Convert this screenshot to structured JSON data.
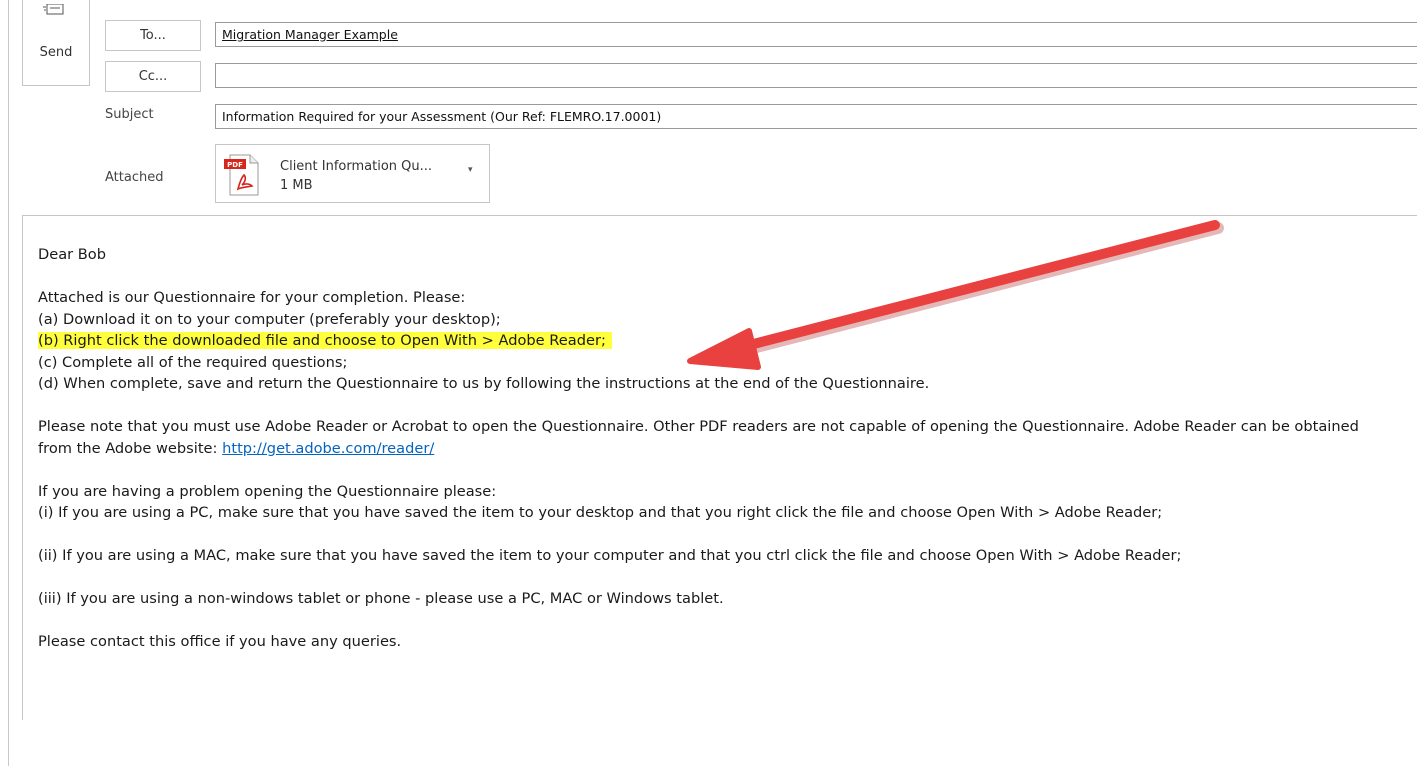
{
  "header": {
    "send_label": "Send",
    "to_button": "To...",
    "cc_button": "Cc...",
    "subject_label": "Subject",
    "attached_label": "Attached",
    "to_value": "Migration Manager Example",
    "cc_value": "",
    "subject_value": "Information Required for your Assessment (Our Ref: FLEMRO.17.0001)"
  },
  "attachment": {
    "name": "Client Information Qu...",
    "size": "1 MB",
    "icon_text": "PDF"
  },
  "body": {
    "greeting": "Dear Bob",
    "intro": "Attached is our Questionnaire for your completion. Please:",
    "step_a": "(a) Download it on to your computer (preferably your desktop);",
    "step_b": "(b) Right click the downloaded file and choose to Open With > Adobe Reader;",
    "step_c": "(c) Complete all of the required questions;",
    "step_d": "(d) When complete, save and return the Questionnaire to us by following the instructions at the end of the Questionnaire.",
    "note_text": "Please note that you must use Adobe Reader or Acrobat to open the Questionnaire. Other PDF readers are not capable of opening the Questionnaire. Adobe Reader can be obtained from the Adobe website: ",
    "note_link": "http://get.adobe.com/reader/",
    "problem_intro": "If you are having a problem opening the Questionnaire please:",
    "problem_i": "(i) If you are using a PC, make sure that you have saved the item to your desktop and that you right click the file and choose Open With > Adobe Reader;",
    "problem_ii": "(ii) If you are using a MAC, make sure that you have saved the item to your computer and that you ctrl click the file and choose Open With > Adobe Reader;",
    "problem_iii": "(iii) If you are using a non-windows tablet or phone - please use a PC, MAC or Windows tablet.",
    "closing": "Please contact this office if you have any queries."
  },
  "colors": {
    "highlight": "#ffff3b",
    "arrow": "#e8413f",
    "link": "#0563c1"
  }
}
